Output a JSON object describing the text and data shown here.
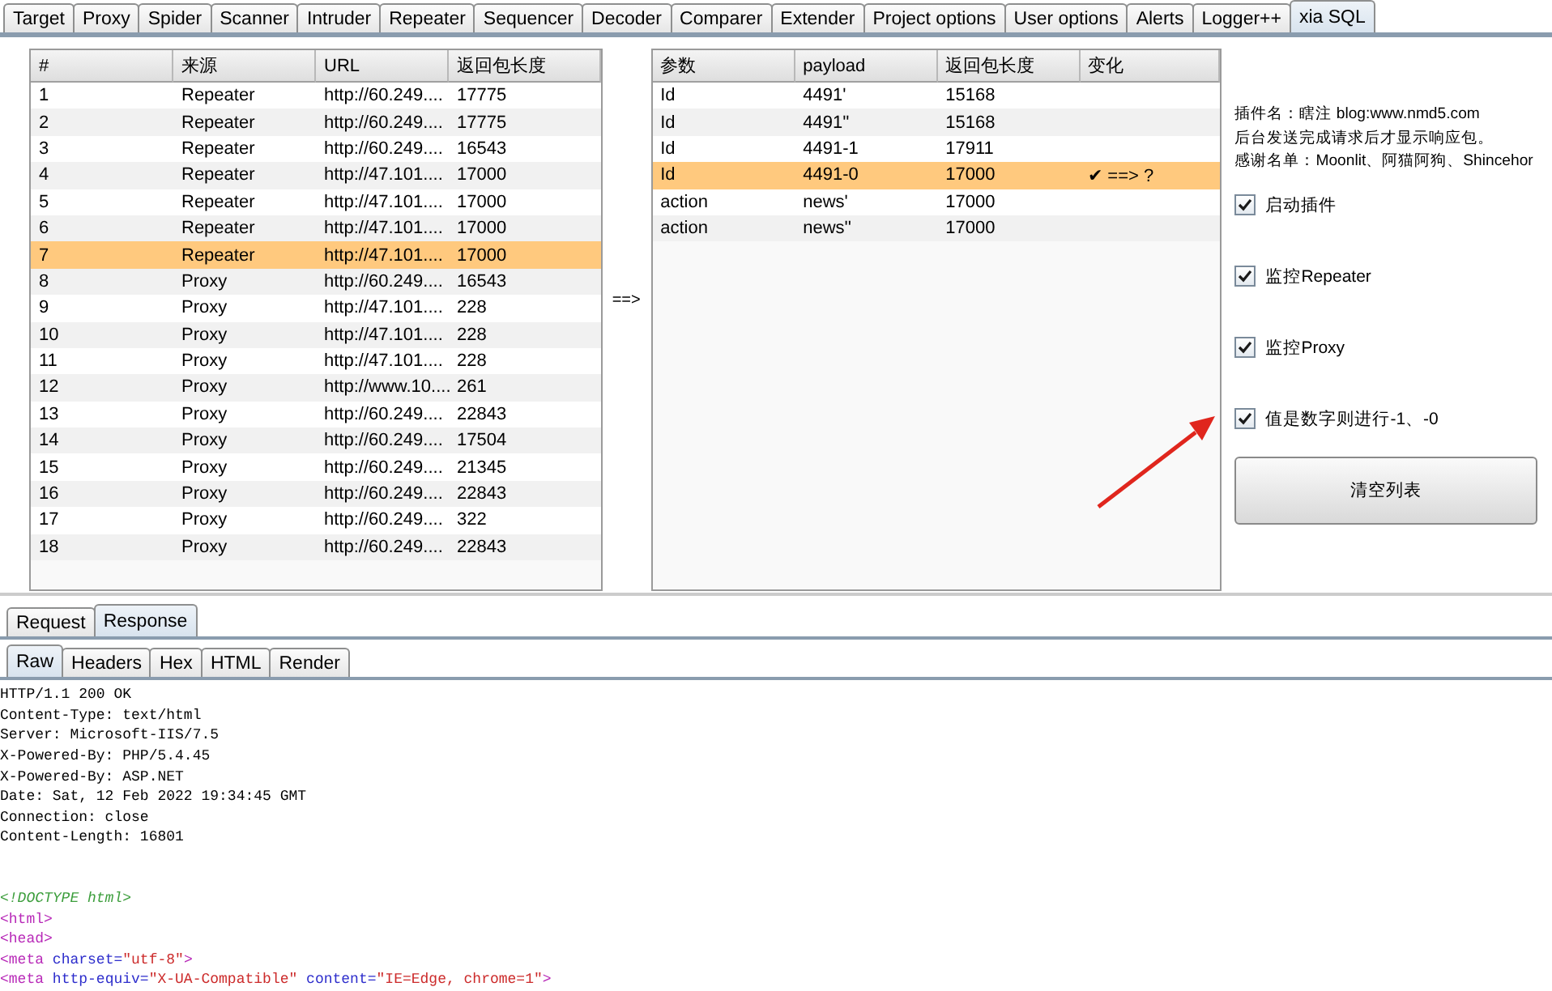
{
  "main_tabs": [
    {
      "label": "Target",
      "selected": false
    },
    {
      "label": "Proxy",
      "selected": false
    },
    {
      "label": "Spider",
      "selected": false
    },
    {
      "label": "Scanner",
      "selected": false
    },
    {
      "label": "Intruder",
      "selected": false
    },
    {
      "label": "Repeater",
      "selected": false
    },
    {
      "label": "Sequencer",
      "selected": false
    },
    {
      "label": "Decoder",
      "selected": false
    },
    {
      "label": "Comparer",
      "selected": false
    },
    {
      "label": "Extender",
      "selected": false
    },
    {
      "label": "Project options",
      "selected": false
    },
    {
      "label": "User options",
      "selected": false
    },
    {
      "label": "Alerts",
      "selected": false
    },
    {
      "label": "Logger++",
      "selected": false
    },
    {
      "label": "xia SQL",
      "selected": true
    }
  ],
  "request_table": {
    "columns": [
      "#",
      "来源",
      "URL",
      "返回包长度"
    ],
    "rows": [
      {
        "cells": [
          "1",
          "Repeater",
          "http://60.249....",
          "17775"
        ],
        "selected": false
      },
      {
        "cells": [
          "2",
          "Repeater",
          "http://60.249....",
          "17775"
        ],
        "selected": false
      },
      {
        "cells": [
          "3",
          "Repeater",
          "http://60.249....",
          "16543"
        ],
        "selected": false
      },
      {
        "cells": [
          "4",
          "Repeater",
          "http://47.101....",
          "17000"
        ],
        "selected": false
      },
      {
        "cells": [
          "5",
          "Repeater",
          "http://47.101....",
          "17000"
        ],
        "selected": false
      },
      {
        "cells": [
          "6",
          "Repeater",
          "http://47.101....",
          "17000"
        ],
        "selected": false
      },
      {
        "cells": [
          "7",
          "Repeater",
          "http://47.101....",
          "17000"
        ],
        "selected": true
      },
      {
        "cells": [
          "8",
          "Proxy",
          "http://60.249....",
          "16543"
        ],
        "selected": false
      },
      {
        "cells": [
          "9",
          "Proxy",
          "http://47.101....",
          "228"
        ],
        "selected": false
      },
      {
        "cells": [
          "10",
          "Proxy",
          "http://47.101....",
          "228"
        ],
        "selected": false
      },
      {
        "cells": [
          "11",
          "Proxy",
          "http://47.101....",
          "228"
        ],
        "selected": false
      },
      {
        "cells": [
          "12",
          "Proxy",
          "http://www.10....",
          "261"
        ],
        "selected": false
      },
      {
        "cells": [
          "13",
          "Proxy",
          "http://60.249....",
          "22843"
        ],
        "selected": false
      },
      {
        "cells": [
          "14",
          "Proxy",
          "http://60.249....",
          "17504"
        ],
        "selected": false
      },
      {
        "cells": [
          "15",
          "Proxy",
          "http://60.249....",
          "21345"
        ],
        "selected": false
      },
      {
        "cells": [
          "16",
          "Proxy",
          "http://60.249....",
          "22843"
        ],
        "selected": false
      },
      {
        "cells": [
          "17",
          "Proxy",
          "http://60.249....",
          "322"
        ],
        "selected": false
      },
      {
        "cells": [
          "18",
          "Proxy",
          "http://60.249....",
          "22843"
        ],
        "selected": false
      }
    ]
  },
  "between_label": "==>",
  "payload_table": {
    "columns": [
      "参数",
      "payload",
      "返回包长度",
      "变化"
    ],
    "rows": [
      {
        "cells": [
          "Id",
          "4491'",
          "15168"
        ],
        "selected": false
      },
      {
        "cells": [
          "Id",
          "4491''",
          "15168"
        ],
        "selected": false
      },
      {
        "cells": [
          "Id",
          "4491-1",
          "17911"
        ],
        "selected": false
      },
      {
        "cells": [
          "Id",
          "4491-0",
          "17000",
          "✔ ==> ?"
        ],
        "selected": true
      },
      {
        "cells": [
          "action",
          "news'",
          "17000"
        ],
        "selected": false
      },
      {
        "cells": [
          "action",
          "news''",
          "17000"
        ],
        "selected": false
      }
    ]
  },
  "info_lines": [
    "插件名：瞎注 blog:www.nmd5.com",
    "后台发送完成请求后才显示响应包。",
    "感谢名单：Moonlit、阿猫阿狗、Shincehor"
  ],
  "options": [
    {
      "label": "启动插件",
      "checked": true
    },
    {
      "label": "监控Repeater",
      "checked": true
    },
    {
      "label": "监控Proxy",
      "checked": true
    },
    {
      "label": "值是数字则进行-1、-0",
      "checked": true
    }
  ],
  "clear_button": "清空列表",
  "message_tabs": [
    {
      "label": "Request",
      "selected": false
    },
    {
      "label": "Response",
      "selected": true
    }
  ],
  "view_tabs": [
    {
      "label": "Raw",
      "selected": true
    },
    {
      "label": "Headers",
      "selected": false
    },
    {
      "label": "Hex",
      "selected": false
    },
    {
      "label": "HTML",
      "selected": false
    },
    {
      "label": "Render",
      "selected": false
    }
  ],
  "response_lines": [
    {
      "segments": [
        {
          "kind": "plain",
          "text": "HTTP/1.1 200 OK"
        }
      ]
    },
    {
      "segments": [
        {
          "kind": "plain",
          "text": "Content-Type: text/html"
        }
      ]
    },
    {
      "segments": [
        {
          "kind": "plain",
          "text": "Server: Microsoft-IIS/7.5"
        }
      ]
    },
    {
      "segments": [
        {
          "kind": "plain",
          "text": "X-Powered-By: PHP/5.4.45"
        }
      ]
    },
    {
      "segments": [
        {
          "kind": "plain",
          "text": "X-Powered-By: ASP.NET"
        }
      ]
    },
    {
      "segments": [
        {
          "kind": "plain",
          "text": "Date: Sat, 12 Feb 2022 19:34:45 GMT"
        }
      ]
    },
    {
      "segments": [
        {
          "kind": "plain",
          "text": "Connection: close"
        }
      ]
    },
    {
      "segments": [
        {
          "kind": "plain",
          "text": "Content-Length: 16801"
        }
      ]
    },
    {
      "gap_before": true,
      "segments": [
        {
          "kind": "doctype",
          "text": "<!DOCTYPE html>"
        }
      ]
    },
    {
      "segments": [
        {
          "kind": "tag",
          "text": "<html>"
        }
      ]
    },
    {
      "segments": [
        {
          "kind": "tag",
          "text": "<head>"
        }
      ]
    },
    {
      "segments": [
        {
          "kind": "tag",
          "text": "<meta"
        },
        {
          "kind": "attr",
          "text": " charset="
        },
        {
          "kind": "value",
          "text": "\"utf-8\""
        },
        {
          "kind": "tag",
          "text": ">"
        }
      ]
    },
    {
      "segments": [
        {
          "kind": "tag",
          "text": "<meta"
        },
        {
          "kind": "attr",
          "text": " http-equiv="
        },
        {
          "kind": "value",
          "text": "\"X-UA-Compatible\""
        },
        {
          "kind": "attr",
          "text": " content="
        },
        {
          "kind": "value",
          "text": "\"IE=Edge, chrome=1\""
        },
        {
          "kind": "tag",
          "text": ">"
        }
      ]
    }
  ]
}
